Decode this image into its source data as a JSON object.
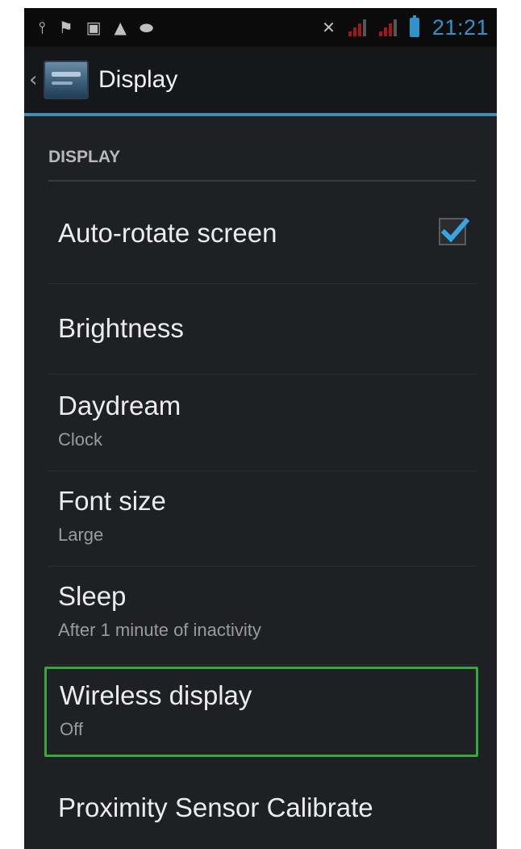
{
  "status_bar": {
    "left_icons": [
      "usb-icon",
      "wifi-icon",
      "screenshot-icon",
      "warning-icon",
      "android-icon"
    ],
    "right_icons": [
      "mute-icon",
      "signal-icon",
      "signal-icon",
      "battery-icon"
    ],
    "time": "21:21"
  },
  "action_bar": {
    "title": "Display"
  },
  "section": {
    "header": "DISPLAY"
  },
  "settings": [
    {
      "title": "Auto-rotate screen",
      "summary": "",
      "checked": true
    },
    {
      "title": "Brightness",
      "summary": ""
    },
    {
      "title": "Daydream",
      "summary": "Clock"
    },
    {
      "title": "Font size",
      "summary": "Large"
    },
    {
      "title": "Sleep",
      "summary": "After 1 minute of inactivity"
    },
    {
      "title": "Wireless display",
      "summary": "Off",
      "highlighted": true
    },
    {
      "title": "Proximity Sensor Calibrate",
      "summary": ""
    }
  ],
  "colors": {
    "accent": "#2f93c9",
    "highlight": "#35a83b",
    "background": "#1f2023"
  }
}
